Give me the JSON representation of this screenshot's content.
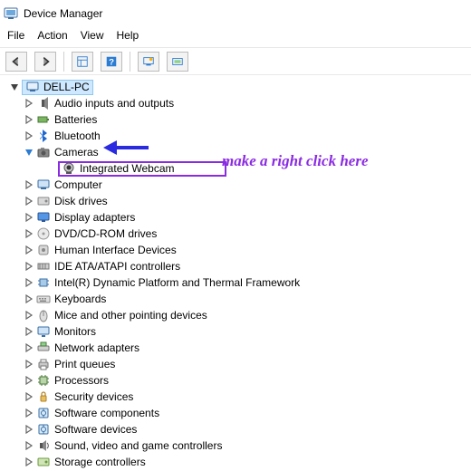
{
  "title": "Device Manager",
  "menu": {
    "file": "File",
    "action": "Action",
    "view": "View",
    "help": "Help"
  },
  "root": "DELL-PC",
  "annotation": "make a right click here",
  "nodes": [
    {
      "label": "Audio inputs and outputs",
      "icon": "audio",
      "expanded": false
    },
    {
      "label": "Batteries",
      "icon": "battery",
      "expanded": false
    },
    {
      "label": "Bluetooth",
      "icon": "bluetooth",
      "expanded": false
    },
    {
      "label": "Cameras",
      "icon": "camera",
      "expanded": true
    },
    {
      "label": "Computer",
      "icon": "computer",
      "expanded": false
    },
    {
      "label": "Disk drives",
      "icon": "disk",
      "expanded": false
    },
    {
      "label": "Display adapters",
      "icon": "display",
      "expanded": false
    },
    {
      "label": "DVD/CD-ROM drives",
      "icon": "dvd",
      "expanded": false
    },
    {
      "label": "Human Interface Devices",
      "icon": "hid",
      "expanded": false
    },
    {
      "label": "IDE ATA/ATAPI controllers",
      "icon": "ide",
      "expanded": false
    },
    {
      "label": "Intel(R) Dynamic Platform and Thermal Framework",
      "icon": "chip",
      "expanded": false
    },
    {
      "label": "Keyboards",
      "icon": "keyboard",
      "expanded": false
    },
    {
      "label": "Mice and other pointing devices",
      "icon": "mouse",
      "expanded": false
    },
    {
      "label": "Monitors",
      "icon": "monitor",
      "expanded": false
    },
    {
      "label": "Network adapters",
      "icon": "network",
      "expanded": false
    },
    {
      "label": "Print queues",
      "icon": "printer",
      "expanded": false
    },
    {
      "label": "Processors",
      "icon": "cpu",
      "expanded": false
    },
    {
      "label": "Security devices",
      "icon": "security",
      "expanded": false
    },
    {
      "label": "Software components",
      "icon": "software",
      "expanded": false
    },
    {
      "label": "Software devices",
      "icon": "software",
      "expanded": false
    },
    {
      "label": "Sound, video and game controllers",
      "icon": "sound",
      "expanded": false
    },
    {
      "label": "Storage controllers",
      "icon": "storage",
      "expanded": false
    }
  ],
  "child": {
    "label": "Integrated Webcam",
    "icon": "webcam"
  }
}
